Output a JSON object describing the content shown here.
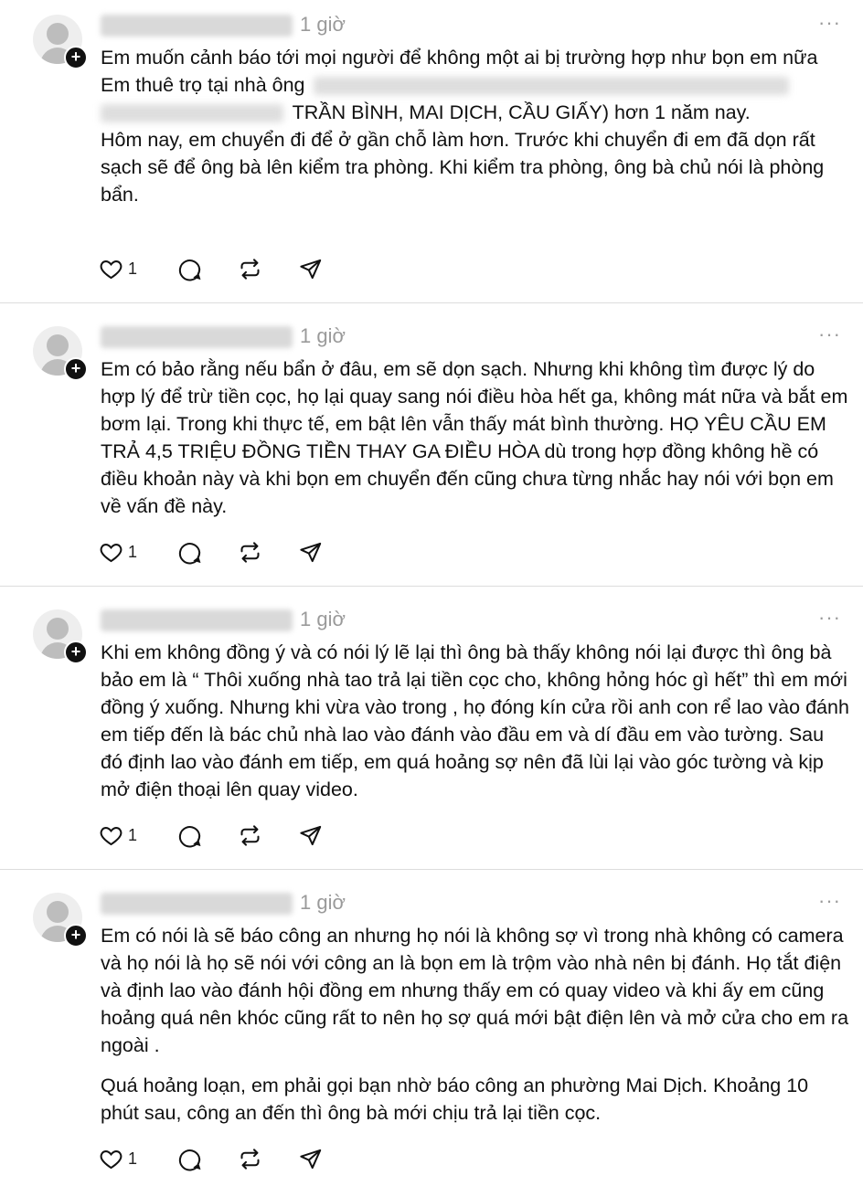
{
  "posts": [
    {
      "username": "username_blurred",
      "time": "1 giờ",
      "more": "···",
      "paragraphs": [],
      "line1": "Em muốn cảnh báo tới mọi người để không một ai bị trường hợp như bọn em nữa",
      "line2_pre": "Em thuê trọ tại nhà ông ",
      "line2_post": "TRẦN BÌNH, MAI DỊCH, CẦU GIẤY) hơn 1 năm nay.",
      "line3": "Hôm nay, em chuyển đi để ở gần chỗ làm hơn. Trước khi chuyển đi em đã dọn rất sạch sẽ để ông bà lên kiểm tra phòng. Khi kiểm tra phòng, ông bà chủ nói là phòng bẩn.",
      "likes": "1"
    },
    {
      "username": "username_blurred",
      "time": "1 giờ",
      "more": "···",
      "paragraphs": [
        "Em có bảo rằng nếu bẩn ở đâu, em sẽ dọn sạch. Nhưng khi không tìm được lý do hợp lý để trừ tiền cọc, họ lại quay sang nói điều hòa hết ga, không mát nữa và bắt em bơm lại. Trong khi thực tế, em bật lên vẫn thấy mát bình thường. HỌ YÊU CẦU EM TRẢ 4,5 TRIỆU ĐỒNG TIỀN THAY GA ĐIỀU HÒA dù trong hợp đồng không hề có điều khoản này và khi bọn em chuyển đến cũng chưa từng nhắc hay nói với bọn em về vấn đề này."
      ],
      "likes": "1"
    },
    {
      "username": "username_blurred",
      "time": "1 giờ",
      "more": "···",
      "paragraphs": [
        "Khi em không đồng ý và có nói lý lẽ lại thì ông bà thấy không nói lại được thì ông bà bảo em là “ Thôi xuống nhà tao trả lại tiền cọc cho, không hỏng hóc gì hết” thì em mới đồng ý xuống. Nhưng khi vừa vào trong , họ đóng kín cửa rồi anh con rể lao vào đánh em tiếp đến là bác chủ nhà lao vào đánh vào đầu em và dí đầu em vào tường. Sau đó định lao vào đánh em tiếp, em quá hoảng sợ nên đã lùi lại vào góc tường và kịp mở điện thoại lên quay video."
      ],
      "likes": "1"
    },
    {
      "username": "username_blurred",
      "time": "1 giờ",
      "more": "···",
      "paragraphs": [
        "Em có nói là sẽ báo công an nhưng họ nói là không sợ vì trong nhà không có camera và họ nói là họ sẽ nói với công an là bọn em là trộm vào nhà nên bị đánh. Họ tắt điện và định lao vào đánh hội đồng em nhưng thấy em có quay video và khi ấy em cũng hoảng quá nên khóc cũng rất to nên họ sợ quá mới bật điện lên và mở cửa cho em ra ngoài .",
        "Quá hoảng loạn, em phải gọi bạn nhờ báo công an phường Mai Dịch. Khoảng 10 phút sau, công an đến thì ông bà mới chịu trả lại tiền cọc."
      ],
      "likes": "1"
    }
  ],
  "icons": [
    "heart-icon",
    "comment-icon",
    "repost-icon",
    "share-icon",
    "avatar-icon",
    "follow-plus-icon",
    "more-icon"
  ]
}
